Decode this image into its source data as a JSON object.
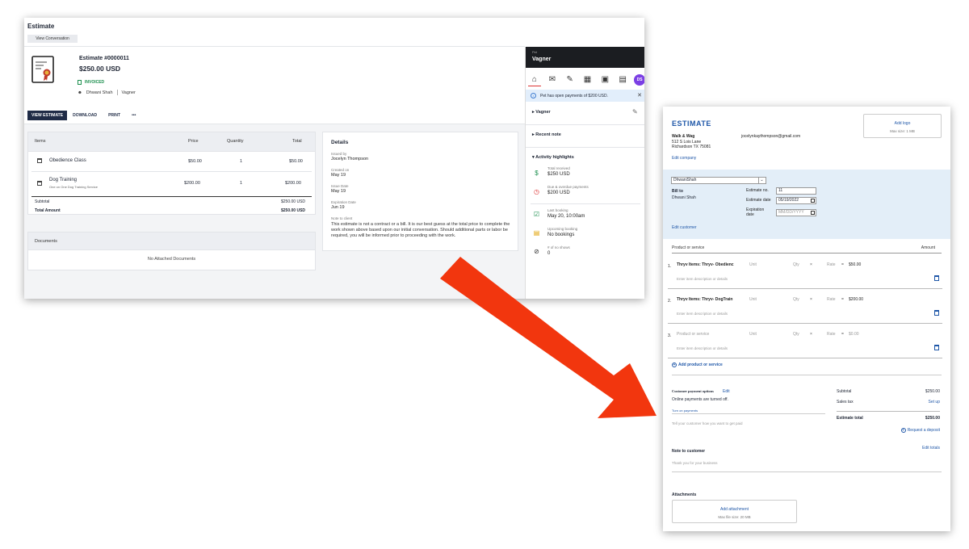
{
  "estimate_view": {
    "title": "Estimate",
    "view_conversation": "View Conversation",
    "estimate_number": "Estimate #0000011",
    "amount": "$250.00 USD",
    "status": "INVOICED",
    "staff": "Dhwani Shah",
    "pet": "Vagner",
    "actions": [
      "VIEW ESTIMATE",
      "DOWNLOAD",
      "PRINT",
      "•••"
    ],
    "items_headers": {
      "items": "Items",
      "price": "Price",
      "quantity": "Quantity",
      "total": "Total"
    },
    "items": [
      {
        "name": "Obedience Class",
        "desc": "",
        "price": "$50.00",
        "qty": "1",
        "total": "$50.00"
      },
      {
        "name": "Dog Training",
        "desc": "One on One Dog Training Service",
        "price": "$200.00",
        "qty": "1",
        "total": "$200.00"
      }
    ],
    "subtotal_label": "Subtotal",
    "subtotal_value": "$250.00 USD",
    "total_label": "Total Amount",
    "total_value": "$250.00 USD",
    "documents_title": "Documents",
    "documents_empty": "No Attached Documents",
    "details": {
      "title": "Details",
      "issued_by_label": "Issued by",
      "issued_by": "Jocelyn Thompson",
      "created_on_label": "Created on",
      "created_on": "May 19",
      "issue_date_label": "Issue Date",
      "issue_date": "May 19",
      "expiration_label": "Expiration Date",
      "expiration": "Jun 19",
      "note_label": "Note to client",
      "note": "This estimate is not a contract or a bill. It is our best guess at the total price to complete the work shown above based upon our initial conversation. Should additional parts or labor be required, you will be informed prior to proceeding with the work."
    },
    "side": {
      "pet_label": "Pet",
      "pet_name": "Vagner",
      "avatar": "DS",
      "alert": "Pet has open payments of $200 USD.",
      "section_pet": "Vagner",
      "section_recent": "Recent note",
      "section_activity": "Activity highlights",
      "highlights": [
        {
          "label": "Total received",
          "value": "$250 USD",
          "icon": "money-icon"
        },
        {
          "label": "Due & overdue payments",
          "value": "$200 USD",
          "icon": "clock-icon"
        },
        {
          "label": "Last booking",
          "value": "May 20, 10:00am",
          "icon": "calendar-check-icon"
        },
        {
          "label": "Upcoming booking",
          "value": "No bookings",
          "icon": "calendar-icon"
        },
        {
          "label": "# of no shows",
          "value": "0",
          "icon": "eye-off-icon"
        }
      ]
    }
  },
  "estimate_form": {
    "title": "ESTIMATE",
    "company_name": "Walk & Wag",
    "address1": "512 S Lois Lane",
    "address2": "Richardson TX 75081",
    "email": "jocelynkaythompson@gmail.com",
    "edit_company": "Edit company",
    "add_logo": "Add logo",
    "logo_size": "Max size: 1 MB",
    "customer_select": "DhwaniShah",
    "bill_to": "Bill to",
    "bill_name": "Dhwani Shah",
    "estimate_no_label": "Estimate no.",
    "estimate_no": "11",
    "estimate_date_label": "Estimate date",
    "estimate_date": "05/19/2022",
    "expiration_label_1": "Expiration",
    "expiration_label_2": "date",
    "expiration_placeholder": "MM/DD/YYYY",
    "edit_customer": "Edit customer",
    "product_header": "Product or service",
    "amount_header": "Amount",
    "lines": [
      {
        "num": "1.",
        "product": "Thryv Items: Thryv- Obedienc",
        "unit": "Unit",
        "qty": "Qty",
        "x": "×",
        "rate": "Rate",
        "rate_value": "$50.00",
        "desc": "Enter item description or details"
      },
      {
        "num": "2.",
        "product": "Thryv Items: Thryv- DogTrain",
        "unit": "Unit",
        "qty": "Qty",
        "x": "×",
        "rate": "Rate",
        "rate_value": "$200.00",
        "desc": "Enter item description or details"
      },
      {
        "num": "3.",
        "product": "Product or service",
        "unit": "Unit",
        "qty": "Qty",
        "x": "×",
        "rate": "Rate",
        "rate_value": "$0.00",
        "desc": "Enter item description or details"
      }
    ],
    "add_product": "Add product or service",
    "payment_options": "Customer payment options",
    "payment_edit": "Edit",
    "payments_off": "Online payments are turned off.",
    "turn_on": "Turn on payments",
    "payment_hint": "Tell your customer how you want to get paid",
    "subtotal_label": "Subtotal",
    "subtotal": "$250.00",
    "sales_tax_label": "Sales tax",
    "sales_tax_action": "Set up",
    "estimate_total_label": "Estimate total",
    "estimate_total": "$250.00",
    "request_deposit": "Request a deposit",
    "edit_totals": "Edit totals",
    "note_title": "Note to customer",
    "note_placeholder": "Thank you for your business",
    "attachments_title": "Attachments",
    "add_attachment": "Add attachment",
    "attachment_size": "Max file size: 20 MB"
  },
  "colors": {
    "arrow": "#f2360e",
    "accent_blue": "#1f57a8",
    "dark_button": "#1f2b46",
    "invoiced_green": "#1c8f4e"
  }
}
